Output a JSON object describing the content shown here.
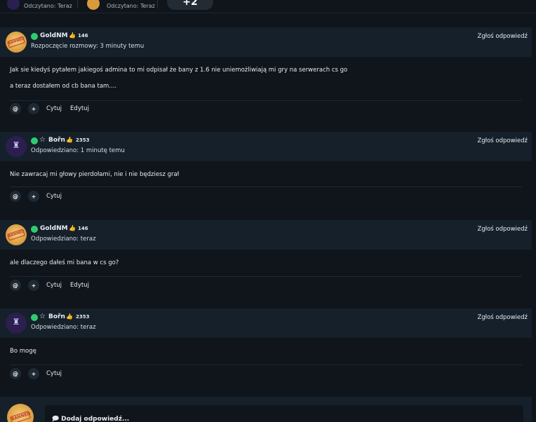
{
  "top_readers": [
    {
      "label": "Odczytano: Teraz"
    },
    {
      "label": "Odczytano: Teraz"
    }
  ],
  "top_button": {
    "label": "+2"
  },
  "posts": [
    {
      "username": "GoldNM",
      "rep": "146",
      "posted": "Rozpoczęcie rozmowy: 3 minuty temu",
      "report": "Zgłoś odpowiedź",
      "lines": [
        "Jak sie kiedyś pytałem jakiegoś admina to mi odpisał że bany z 1.6 nie uniemożliwiają mi gry na serwerach cs go",
        "a teraz dostałem od cb bana tam...."
      ],
      "actions": [
        "Cytuj",
        "Edytuj"
      ],
      "avatar_stamp": "BANNED"
    },
    {
      "username": "Bořn",
      "rep": "2353",
      "posted": "Odpowiedziano: 1 minutę temu",
      "report": "Zgłoś odpowiedź",
      "lines": [
        "Nie zawracaj mi głowy pierdołami, nie i nie będziesz grał"
      ],
      "actions": [
        "Cytuj"
      ]
    },
    {
      "username": "GoldNM",
      "rep": "146",
      "posted": "Odpowiedziano: teraz",
      "report": "Zgłoś odpowiedź",
      "lines": [
        "ale dlaczego dałeś mi bana w cs go?"
      ],
      "actions": [
        "Cytuj",
        "Edytuj"
      ],
      "avatar_stamp": "BANNED"
    },
    {
      "username": "Bořn",
      "rep": "2353",
      "posted": "Odpowiedziano: teraz",
      "report": "Zgłoś odpowiedź",
      "lines": [
        "Bo mogę"
      ],
      "actions": [
        "Cytuj"
      ]
    }
  ],
  "reply": {
    "placeholder": "Dodaj odpowiedź..."
  },
  "icons": {
    "mention": "@",
    "plus": "+"
  },
  "colors": {
    "online": "#2ecc71",
    "rep_thumb": "#2ecc71",
    "bg": "#0f151b",
    "panel": "#16202a"
  }
}
